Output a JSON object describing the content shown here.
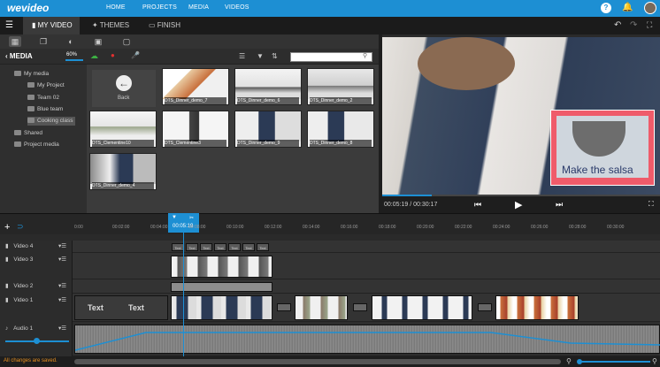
{
  "brand": {
    "logo": "wevideo",
    "accent": "#1d8fd3"
  },
  "topnav": [
    "HOME",
    "PROJECTS",
    "MEDIA",
    "VIDEOS"
  ],
  "topicons": [
    "help-icon",
    "bell-icon",
    "gear-icon"
  ],
  "tabs": [
    {
      "label": "MY VIDEO",
      "icon": "film-icon",
      "active": true
    },
    {
      "label": "THEMES",
      "icon": "wand-icon",
      "active": false
    },
    {
      "label": "FINISH",
      "icon": "clapper-icon",
      "active": false
    }
  ],
  "media": {
    "title": "MEDIA",
    "progress": "60%",
    "search_placeholder": "",
    "tree": [
      {
        "label": "My media",
        "level": 0
      },
      {
        "label": "My Project",
        "level": 1
      },
      {
        "label": "Team 02",
        "level": 1
      },
      {
        "label": "Blue team",
        "level": 1
      },
      {
        "label": "Cooking class",
        "level": 1,
        "selected": true
      },
      {
        "label": "Shared",
        "level": 0
      },
      {
        "label": "Project media",
        "level": 0
      }
    ],
    "back_label": "Back",
    "items": [
      "DTS_Dinner_demo_7",
      "DTS_Dinner_demo_6",
      "DTS_Dinner_demo_2",
      "DTS_Clementine10",
      "DTS_Clementine3",
      "DTS_Dinner_demo_9",
      "DTS_Dinner_demo_8",
      "DTS_Dinner_demo_4"
    ]
  },
  "preview": {
    "overlay_text": "Make the salsa",
    "time": "00:05:19 / 00:30:17"
  },
  "timeline": {
    "playhead_time": "00:05:19",
    "ticks": [
      "0:00",
      "00:02:00",
      "00:04:00",
      "00:05:19",
      "00:08:00",
      "00:10:00",
      "00:12:00",
      "00:14:00",
      "00:16:00",
      "00:18:00",
      "00:20:00",
      "00:22:00",
      "00:24:00",
      "00:26:00",
      "00:28:00",
      "00:30:00"
    ],
    "tracks": [
      "Video 4",
      "Video 3",
      "Video 2",
      "Video 1",
      "Audio 1"
    ],
    "text_clip_labels": [
      "Text",
      "Text"
    ],
    "small_text_labels": [
      "Text",
      "Text",
      "Text",
      "Text",
      "Text",
      "Text",
      "Text"
    ]
  },
  "status": "All changes are saved."
}
